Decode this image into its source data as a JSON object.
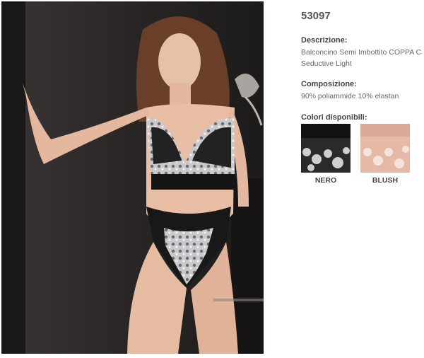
{
  "product": {
    "code": "53097",
    "description_label": "Descrizione:",
    "description_line1": "Balconcino Semi Imbottito COPPA C",
    "description_line2": "Seductive Light",
    "composition_label": "Composizione:",
    "composition_value": "90% poliammide 10% elastan",
    "colors_label": "Colori disponibili:",
    "colors": [
      {
        "name": "NERO",
        "hex": "#1e1e1e"
      },
      {
        "name": "BLUSH",
        "hex": "#e4b7a6"
      }
    ]
  }
}
